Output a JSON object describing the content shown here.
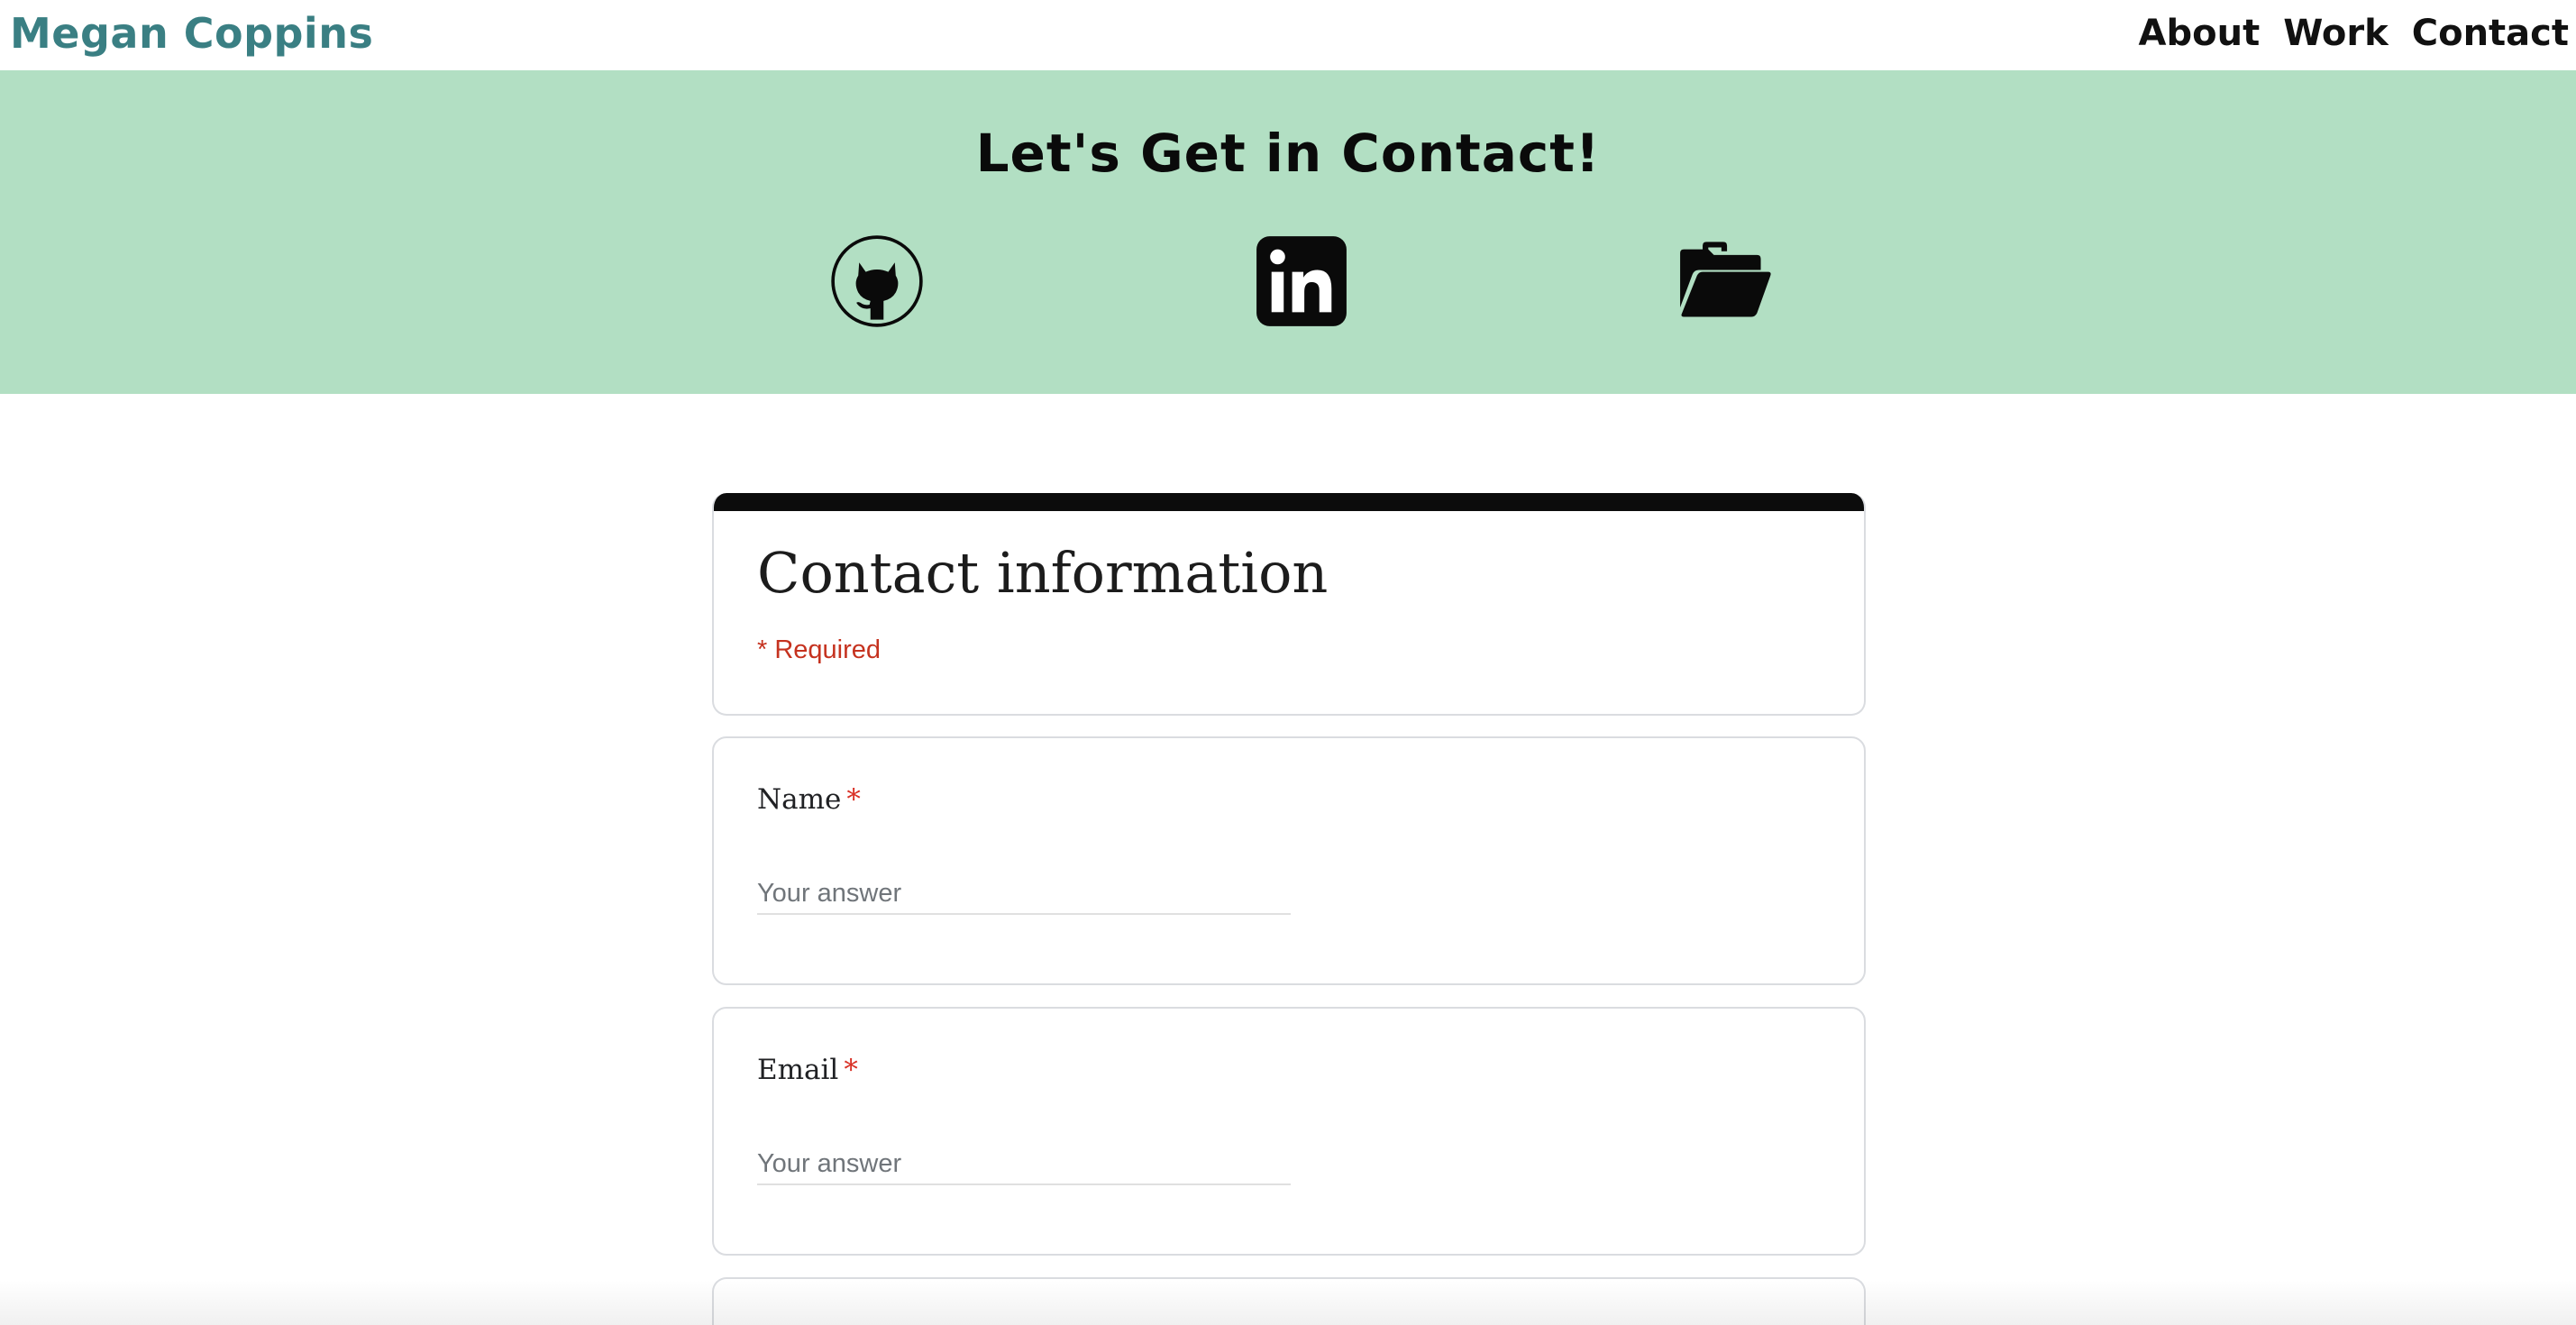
{
  "header": {
    "brand": "Megan Coppins",
    "nav": [
      {
        "label": "About"
      },
      {
        "label": "Work"
      },
      {
        "label": "Contact"
      }
    ]
  },
  "hero": {
    "title": "Let's Get in Contact!",
    "links": [
      {
        "icon": "github-icon"
      },
      {
        "icon": "linkedin-icon"
      },
      {
        "icon": "folder-open-icon"
      }
    ]
  },
  "form": {
    "title": "Contact information",
    "required_note": "* Required",
    "questions": [
      {
        "label": "Name",
        "required_mark": "*",
        "placeholder": "Your answer",
        "value": ""
      },
      {
        "label": "Email",
        "required_mark": "*",
        "placeholder": "Your answer",
        "value": ""
      }
    ]
  },
  "colors": {
    "brand": "#3a7f83",
    "hero_bg": "#b2dfc3",
    "required": "#d93025",
    "card_border": "#dadce0"
  }
}
